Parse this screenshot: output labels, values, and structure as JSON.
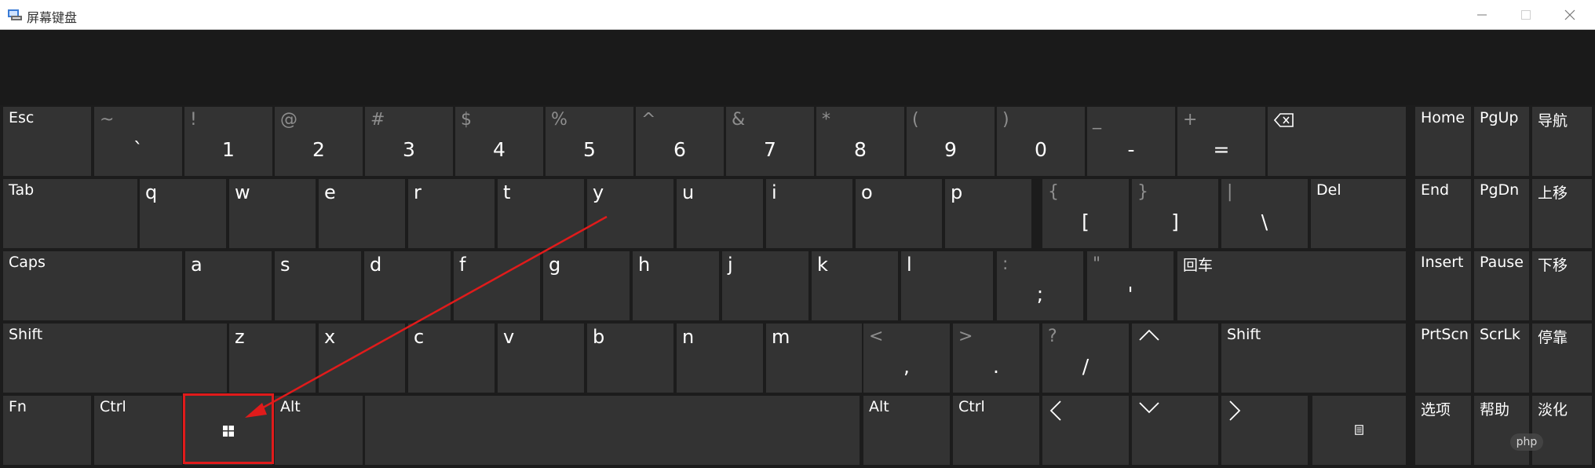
{
  "window": {
    "title": "屏幕键盘",
    "controls": {
      "minimize": "minimize-icon",
      "maximize": "maximize-icon",
      "close": "close-icon"
    }
  },
  "keys": {
    "esc": {
      "label": "Esc"
    },
    "tilde": {
      "secondary": "~",
      "primary": "`"
    },
    "k1": {
      "secondary": "!",
      "primary": "1"
    },
    "k2": {
      "secondary": "@",
      "primary": "2"
    },
    "k3": {
      "secondary": "#",
      "primary": "3"
    },
    "k4": {
      "secondary": "$",
      "primary": "4"
    },
    "k5": {
      "secondary": "%",
      "primary": "5"
    },
    "k6": {
      "secondary": "^",
      "primary": "6"
    },
    "k7": {
      "secondary": "&",
      "primary": "7"
    },
    "k8": {
      "secondary": "*",
      "primary": "8"
    },
    "k9": {
      "secondary": "(",
      "primary": "9"
    },
    "k0": {
      "secondary": ")",
      "primary": "0"
    },
    "minus": {
      "secondary": "_",
      "primary": "-"
    },
    "equals": {
      "secondary": "+",
      "primary": "="
    },
    "backspace": {
      "icon": "backspace-icon"
    },
    "tab": {
      "label": "Tab"
    },
    "q": {
      "label": "q"
    },
    "w": {
      "label": "w"
    },
    "e": {
      "label": "e"
    },
    "r": {
      "label": "r"
    },
    "t": {
      "label": "t"
    },
    "y": {
      "label": "y"
    },
    "u": {
      "label": "u"
    },
    "i": {
      "label": "i"
    },
    "o": {
      "label": "o"
    },
    "p": {
      "label": "p"
    },
    "lbracket": {
      "secondary": "{",
      "primary": "["
    },
    "rbracket": {
      "secondary": "}",
      "primary": "]"
    },
    "backslash": {
      "secondary": "|",
      "primary": "\\"
    },
    "del": {
      "label": "Del"
    },
    "caps": {
      "label": "Caps"
    },
    "a": {
      "label": "a"
    },
    "s": {
      "label": "s"
    },
    "d": {
      "label": "d"
    },
    "f": {
      "label": "f"
    },
    "g": {
      "label": "g"
    },
    "h": {
      "label": "h"
    },
    "j": {
      "label": "j"
    },
    "k": {
      "label": "k"
    },
    "l": {
      "label": "l"
    },
    "semicolon": {
      "secondary": ":",
      "primary": ";"
    },
    "quote": {
      "secondary": "\"",
      "primary": "'"
    },
    "enter": {
      "label": "回车"
    },
    "lshift": {
      "label": "Shift"
    },
    "z": {
      "label": "z"
    },
    "x": {
      "label": "x"
    },
    "c": {
      "label": "c"
    },
    "v": {
      "label": "v"
    },
    "b": {
      "label": "b"
    },
    "n": {
      "label": "n"
    },
    "m": {
      "label": "m"
    },
    "comma": {
      "secondary": "<",
      "primary": ","
    },
    "period": {
      "secondary": ">",
      "primary": "."
    },
    "slash": {
      "secondary": "?",
      "primary": "/"
    },
    "up": {
      "icon": "arrow-up-icon"
    },
    "rshift": {
      "label": "Shift"
    },
    "fn": {
      "label": "Fn"
    },
    "lctrl": {
      "label": "Ctrl"
    },
    "win": {
      "icon": "windows-logo-icon"
    },
    "lalt": {
      "label": "Alt"
    },
    "space": {
      "label": ""
    },
    "ralt": {
      "label": "Alt"
    },
    "rctrl": {
      "label": "Ctrl"
    },
    "left": {
      "icon": "arrow-left-icon"
    },
    "down": {
      "icon": "arrow-down-icon"
    },
    "right": {
      "icon": "arrow-right-icon"
    },
    "menu": {
      "icon": "context-menu-icon"
    },
    "home": {
      "label": "Home"
    },
    "pgup": {
      "label": "PgUp"
    },
    "nav": {
      "label": "导航"
    },
    "end": {
      "label": "End"
    },
    "pgdn": {
      "label": "PgDn"
    },
    "moveup": {
      "label": "上移"
    },
    "insert": {
      "label": "Insert"
    },
    "pause": {
      "label": "Pause"
    },
    "movedown": {
      "label": "下移"
    },
    "prtscn": {
      "label": "PrtScn"
    },
    "scrlk": {
      "label": "ScrLk"
    },
    "dock": {
      "label": "停靠"
    },
    "options": {
      "label": "选项"
    },
    "help": {
      "label": "帮助"
    },
    "fade": {
      "label": "淡化"
    }
  },
  "annotation": {
    "color": "#e01b1b",
    "target": "win"
  },
  "watermark": {
    "text": "php"
  }
}
